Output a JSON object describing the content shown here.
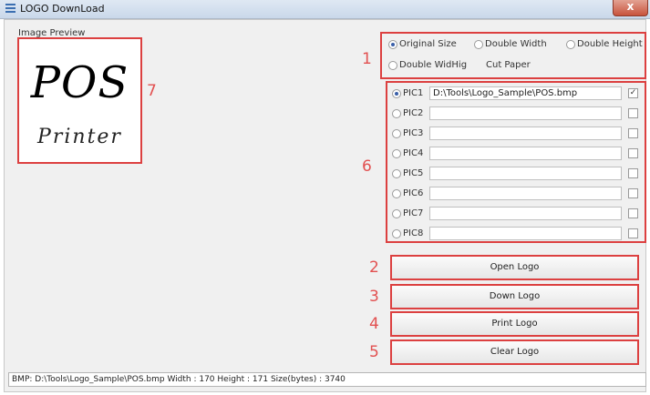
{
  "window": {
    "title": "LOGO DownLoad",
    "close_glyph": "x"
  },
  "preview": {
    "label": "Image Preview",
    "logo_line1": "POS",
    "logo_line2": "Printer",
    "callout": "7"
  },
  "size_options": {
    "callout": "1",
    "items": [
      {
        "label": "Original Size",
        "selected": true
      },
      {
        "label": "Double Width",
        "selected": false
      },
      {
        "label": "Double Height",
        "selected": false
      },
      {
        "label": "Double WidHig",
        "selected": false
      }
    ],
    "cut_paper_label": "Cut Paper"
  },
  "pictures": {
    "callout": "6",
    "items": [
      {
        "label": "PIC1",
        "path": "D:\\Tools\\Logo_Sample\\POS.bmp",
        "selected": true,
        "checked": true
      },
      {
        "label": "PIC2",
        "path": "",
        "selected": false,
        "checked": false
      },
      {
        "label": "PIC3",
        "path": "",
        "selected": false,
        "checked": false
      },
      {
        "label": "PIC4",
        "path": "",
        "selected": false,
        "checked": false
      },
      {
        "label": "PIC5",
        "path": "",
        "selected": false,
        "checked": false
      },
      {
        "label": "PIC6",
        "path": "",
        "selected": false,
        "checked": false
      },
      {
        "label": "PIC7",
        "path": "",
        "selected": false,
        "checked": false
      },
      {
        "label": "PIC8",
        "path": "",
        "selected": false,
        "checked": false
      }
    ]
  },
  "buttons": {
    "open": {
      "label": "Open Logo",
      "callout": "2"
    },
    "down": {
      "label": "Down Logo",
      "callout": "3"
    },
    "print": {
      "label": "Print Logo",
      "callout": "4"
    },
    "clear": {
      "label": "Clear Logo",
      "callout": "5"
    }
  },
  "status": {
    "text": "BMP: D:\\Tools\\Logo_Sample\\POS.bmp  Width : 170  Height : 171  Size(bytes) : 3740"
  },
  "colors": {
    "callout": "#dc4040",
    "title_bar": "#c9d8ea",
    "client_bg": "#f0f0f0"
  }
}
